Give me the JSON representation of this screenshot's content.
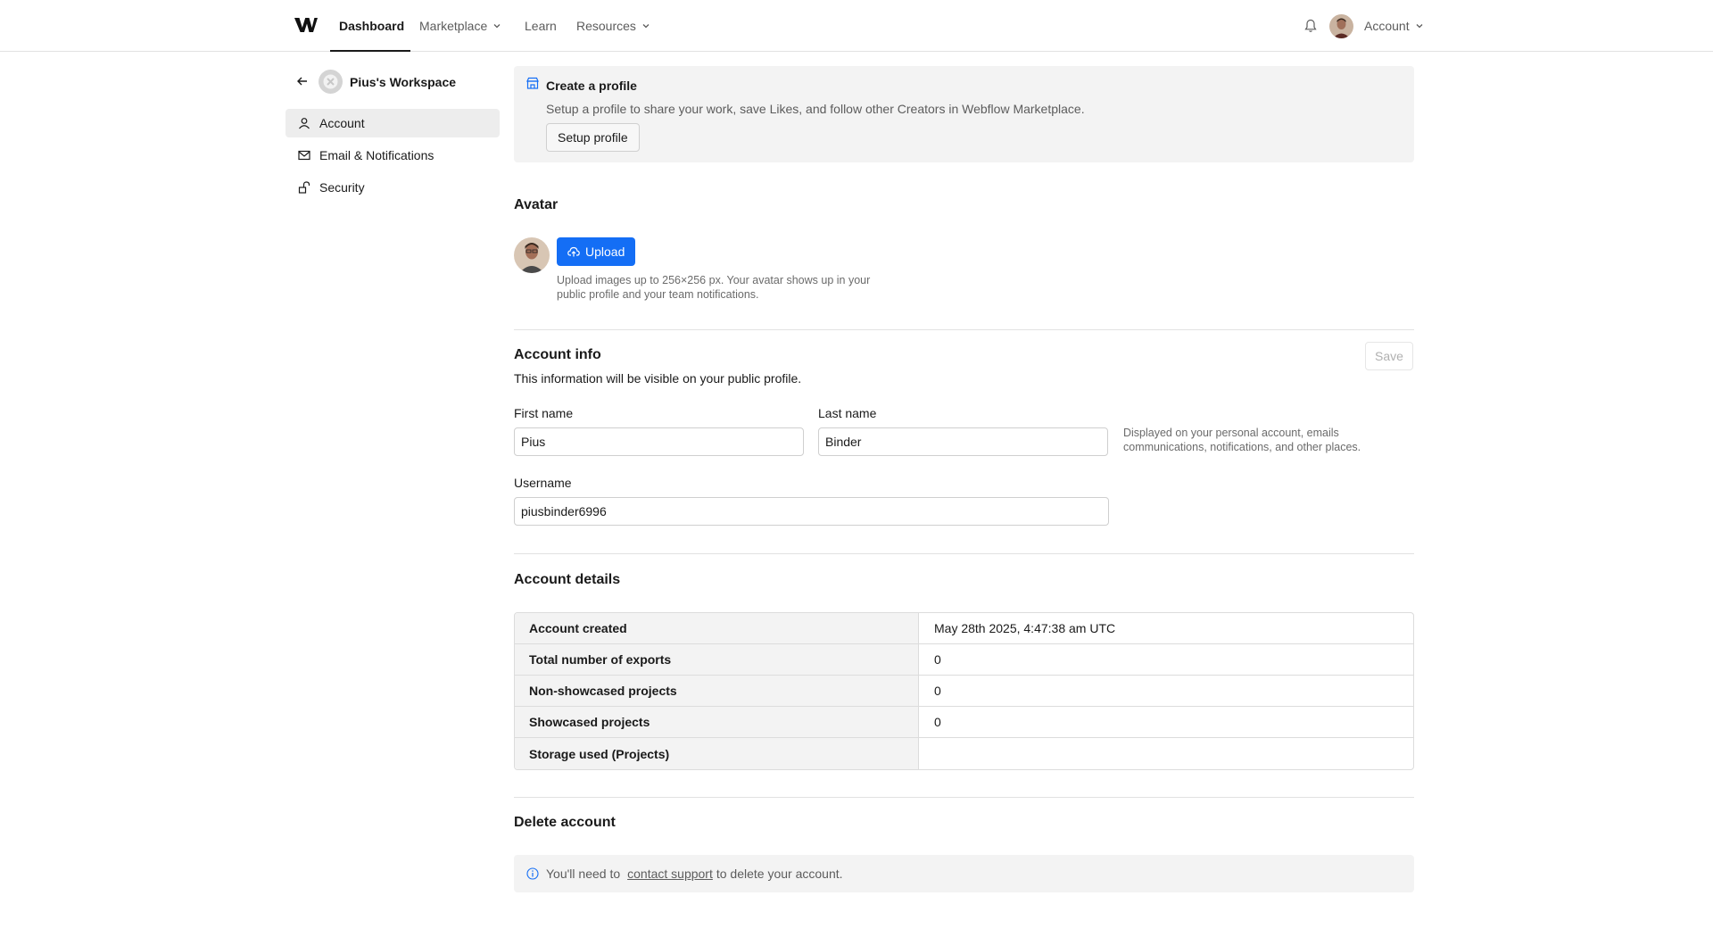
{
  "nav": {
    "items": [
      {
        "label": "Dashboard",
        "has_chevron": false,
        "active": true
      },
      {
        "label": "Marketplace",
        "has_chevron": true,
        "active": false
      },
      {
        "label": "Learn",
        "has_chevron": false,
        "active": false
      },
      {
        "label": "Resources",
        "has_chevron": true,
        "active": false
      }
    ],
    "account_label": "Account"
  },
  "sidebar": {
    "workspace_name": "Pius's Workspace",
    "items": [
      {
        "label": "Account",
        "icon": "user-icon",
        "active": true
      },
      {
        "label": "Email & Notifications",
        "icon": "mail-icon",
        "active": false
      },
      {
        "label": "Security",
        "icon": "unlock-icon",
        "active": false
      }
    ]
  },
  "profile_banner": {
    "title": "Create a profile",
    "description": "Setup a profile to share your work, save Likes, and follow other Creators in Webflow Marketplace.",
    "button_label": "Setup profile"
  },
  "avatar": {
    "title": "Avatar",
    "upload_label": "Upload",
    "help_text": "Upload images up to 256×256 px. Your avatar shows up in your public profile and your team notifications."
  },
  "account_info": {
    "title": "Account info",
    "subtitle": "This information will be visible on your public profile.",
    "save_label": "Save",
    "first_name_label": "First name",
    "first_name_value": "Pius",
    "last_name_label": "Last name",
    "last_name_value": "Binder",
    "name_help": "Displayed on your personal account, emails communications, notifications, and other places.",
    "username_label": "Username",
    "username_value": "piusbinder6996"
  },
  "account_details": {
    "title": "Account details",
    "rows": [
      {
        "key": "Account created",
        "value": "May 28th 2025, 4:47:38 am UTC"
      },
      {
        "key": "Total number of exports",
        "value": "0"
      },
      {
        "key": "Non-showcased projects",
        "value": "0"
      },
      {
        "key": "Showcased projects",
        "value": "0"
      },
      {
        "key": "Storage used (Projects)",
        "value": ""
      }
    ]
  },
  "delete_account": {
    "title": "Delete account",
    "text_before": "You'll need to",
    "link_text": "contact support",
    "text_after": "to delete your account."
  },
  "colors": {
    "accent": "#146ef5",
    "panel": "#f3f3f3",
    "border": "#e2e2e2"
  }
}
